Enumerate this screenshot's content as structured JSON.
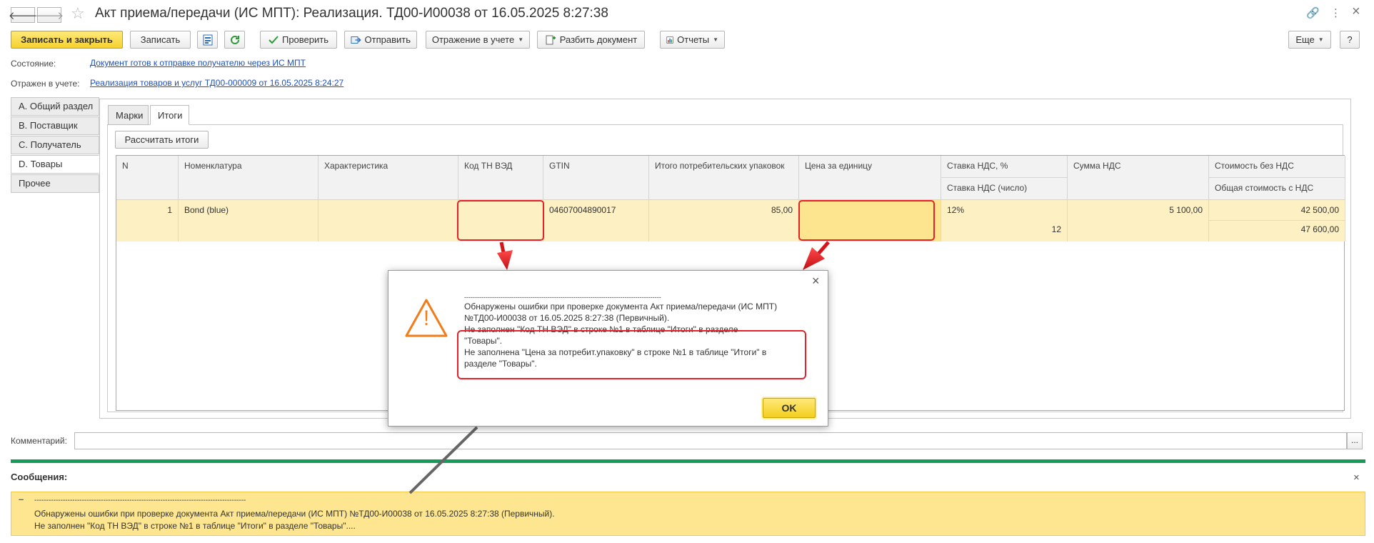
{
  "window": {
    "title": "Акт приема/передачи (ИС МПТ): Реализация.  ТД00-И00038 от 16.05.2025 8:27:38",
    "back_glyph": "🡐",
    "forward_glyph": "🡒",
    "star_glyph": "☆",
    "link_glyph": "🔗",
    "more_glyph": "⋮",
    "close_glyph": "×"
  },
  "toolbar": {
    "save_close": "Записать и закрыть",
    "save": "Записать",
    "check": "Проверить",
    "send": "Отправить",
    "reflection": "Отражение в учете",
    "split": "Разбить документ",
    "reports": "Отчеты",
    "more": "Еще",
    "help": "?"
  },
  "status": {
    "state_label": "Состояние:",
    "state_value": "Документ готов к отправке получателю через ИС МПТ",
    "reflected_label": "Отражен в учете:",
    "reflected_value": "Реализация товаров и услуг ТД00-000009 от 16.05.2025 8:24:27"
  },
  "sections": [
    {
      "label": "A. Общий раздел"
    },
    {
      "label": "B. Поставщик"
    },
    {
      "label": "C. Получатель"
    },
    {
      "label": "D. Товары"
    },
    {
      "label": "Прочее"
    }
  ],
  "tabs": [
    {
      "label": "Марки"
    },
    {
      "label": "Итоги"
    }
  ],
  "calc_button": "Рассчитать итоги",
  "table": {
    "headers": {
      "n": "N",
      "nomenclature": "Номенклатура",
      "characteristic": "Характеристика",
      "tnved": "Код ТН ВЭД",
      "gtin": "GTIN",
      "total_packs": "Итого потребительских упаковок",
      "unit_price": "Цена за единицу",
      "vat_rate": "Ставка НДС, %",
      "vat_rate_num": "Ставка НДС (число)",
      "vat_sum": "Сумма НДС",
      "cost_no_vat": "Стоимость без НДС",
      "total_with_vat": "Общая стоимость с НДС"
    },
    "row": {
      "n": "1",
      "nomenclature": "Bond (blue)",
      "characteristic": "",
      "tnved": "",
      "gtin": "04607004890017",
      "total_packs": "85,00",
      "unit_price": "",
      "vat_rate": "12%",
      "vat_rate_num": "12",
      "vat_sum": "5 100,00",
      "cost_no_vat": "42 500,00",
      "total_with_vat": "47 600,00"
    }
  },
  "comment_label": "Комментарий:",
  "comment_value": "",
  "comment_dots": "...",
  "messages": {
    "title": "Сообщения:",
    "collapse": "–",
    "separator": "-----------------------------------------------------------------------------------------",
    "line1": "Обнаружены ошибки при проверке документа Акт приема/передачи (ИС МПТ) №ТД00-И00038 от 16.05.2025 8:27:38 (Первичный).",
    "line2": "Не заполнен \"Код ТН ВЭД\" в строке №1 в таблице \"Итоги\" в разделе \"Товары\"...."
  },
  "dialog": {
    "separator": "--------------------------------------------------------------------------------------------",
    "line1": "Обнаружены ошибки при проверке документа Акт приема/передачи (ИС МПТ)",
    "line2": "№ТД00-И00038 от 16.05.2025 8:27:38 (Первичный).",
    "line3": "Не заполнен \"Код ТН ВЭД\" в строке №1 в таблице \"Итоги\" в разделе",
    "line4": "\"Товары\".",
    "line5": "Не заполнена \"Цена за потребит.упаковку\" в строке №1 в таблице \"Итоги\" в",
    "line6": "разделе \"Товары\".",
    "ok": "OK",
    "warning_mark": "!"
  },
  "colors": {
    "accent_yellow": "#f6d22e",
    "row_highlight": "#fdf0c3",
    "error_red": "#e8202a",
    "link_blue": "#2150b8",
    "messages_green": "#1a9a58",
    "warning_orange": "#f07c1a"
  }
}
